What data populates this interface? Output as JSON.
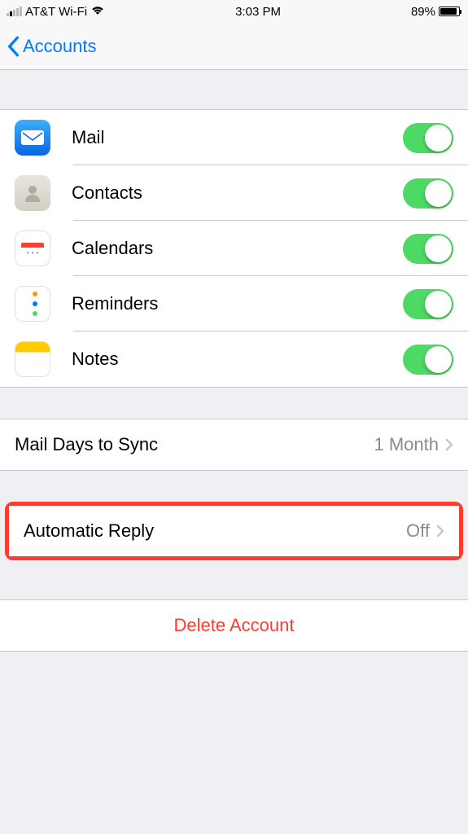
{
  "statusBar": {
    "carrier": "AT&T Wi-Fi",
    "time": "3:03 PM",
    "batteryPercent": "89%"
  },
  "navBar": {
    "backLabel": "Accounts"
  },
  "services": [
    {
      "label": "Mail",
      "enabled": true
    },
    {
      "label": "Contacts",
      "enabled": true
    },
    {
      "label": "Calendars",
      "enabled": true
    },
    {
      "label": "Reminders",
      "enabled": true
    },
    {
      "label": "Notes",
      "enabled": true
    }
  ],
  "mailSync": {
    "label": "Mail Days to Sync",
    "value": "1 Month"
  },
  "autoReply": {
    "label": "Automatic Reply",
    "value": "Off"
  },
  "deleteAccount": {
    "label": "Delete Account"
  }
}
